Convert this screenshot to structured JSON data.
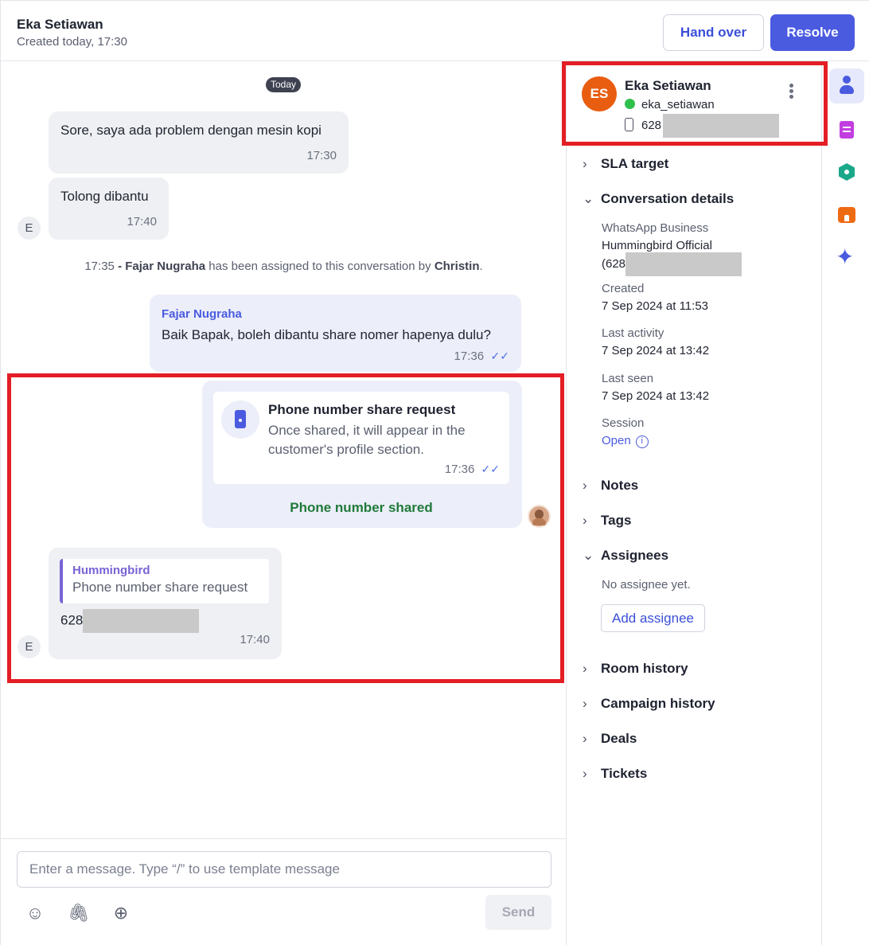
{
  "header": {
    "title": "Eka Setiawan",
    "subtitle": "Created today, 17:30",
    "handover_label": "Hand over",
    "resolve_label": "Resolve"
  },
  "chat": {
    "date_pill": "Today",
    "messages": [
      {
        "text": "Sore, saya ada problem dengan mesin kopi",
        "time": "17:30"
      },
      {
        "text": "Tolong dibantu",
        "time": "17:40"
      }
    ],
    "customer_initial": "E",
    "system": {
      "time": "17:35",
      "separator": "-",
      "agent": "Fajar Nugraha",
      "middle": "has been assigned to this conversation by",
      "by": "Christin",
      "end": "."
    },
    "agent_message": {
      "sender": "Fajar Nugraha",
      "text": "Baik Bapak, boleh dibantu share nomer hapenya dulu?",
      "time": "17:36"
    },
    "share_request": {
      "title": "Phone number share request",
      "body": "Once shared, it will appear in the customer's profile section.",
      "time": "17:36",
      "status": "Phone number shared"
    },
    "reply": {
      "quote_name": "Hummingbird",
      "quote_text": "Phone number share request",
      "phone_prefix": "628",
      "time": "17:40"
    },
    "composer_placeholder": "Enter a message. Type “/” to use template message",
    "send_label": "Send",
    "tools": {
      "emoji": "☺",
      "attach": "🖇",
      "add": "⊕"
    }
  },
  "profile": {
    "initials": "ES",
    "name": "Eka Setiawan",
    "handle": "eka_setiawan",
    "phone_prefix": "628",
    "avatar_color": "#e85d0f"
  },
  "panel": {
    "sla": "SLA target",
    "conversation_details": "Conversation details",
    "channel_label": "WhatsApp Business",
    "channel_name": "Hummingbird Official",
    "channel_phone_prefix": "(628",
    "created_label": "Created",
    "created_value": "7 Sep 2024 at 11:53",
    "last_activity_label": "Last activity",
    "last_activity_value": "7 Sep 2024 at 13:42",
    "last_seen_label": "Last seen",
    "last_seen_value": "7 Sep 2024 at 13:42",
    "session_label": "Session",
    "session_value": "Open",
    "notes": "Notes",
    "tags": "Tags",
    "assignees": "Assignees",
    "no_assignee": "No assignee yet.",
    "add_assignee": "Add assignee",
    "room_history": "Room history",
    "campaign_history": "Campaign history",
    "deals": "Deals",
    "tickets": "Tickets"
  },
  "rail": {
    "icons": [
      "person-icon",
      "notes-icon",
      "hexagon-icon",
      "store-icon",
      "sparkle-icon"
    ],
    "sparkle": "✦"
  },
  "colors": {
    "accent": "#4a5be0",
    "highlight_border": "#e41e25",
    "shared_green": "#1f7a3a",
    "whatsapp_green": "#2fc04c"
  }
}
